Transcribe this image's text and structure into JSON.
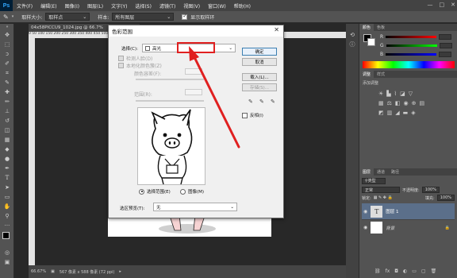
{
  "menubar": {
    "logo": "Ps",
    "items": [
      "文件(F)",
      "编辑(E)",
      "图像(I)",
      "图层(L)",
      "文字(Y)",
      "选择(S)",
      "滤镜(T)",
      "视图(V)",
      "窗口(W)",
      "帮助(H)"
    ],
    "controls": [
      "—",
      "□",
      "✕"
    ]
  },
  "optionsbar": {
    "sample_size_label": "取样大小:",
    "sample_size_value": "取样点",
    "sample_label": "样本:",
    "sample_value": "所有图层",
    "show_ring_label": "显示取样环"
  },
  "document": {
    "tab_title": "04x58PICCU9_1024.jpg @ 66.7%",
    "ruler_marks": "0    50    100   150   200   250   300   350   400   450   500",
    "zoom": "66.67%",
    "doc_info": "567 像素 x 588 像素 (72 ppi)"
  },
  "dialog": {
    "title": "色彩范围",
    "select_label": "选择(C):",
    "select_value": "高光",
    "detect_faces": "检测人脸(D)",
    "localized": "本地化颜色簇(Z)",
    "fuzziness": "颜色容差(F):",
    "range": "范围(R):",
    "ok": "确定",
    "cancel": "取消",
    "load": "载入(L)...",
    "save": "存储(S)...",
    "invert": "反相(I)",
    "radio_selection": "选择范围(E)",
    "radio_image": "图像(M)",
    "preview_label": "选区预览(T):",
    "preview_value": "无"
  },
  "panels": {
    "color_tabs": [
      "颜色",
      "色板"
    ],
    "rgb": [
      "R",
      "G",
      "B"
    ],
    "rgb_values": [
      "",
      "",
      ""
    ],
    "adjust_tabs": [
      "调整",
      "样式"
    ],
    "adjust_label": "添加调整",
    "layer_tabs": [
      "图层",
      "通道",
      "路径"
    ],
    "kind_label": "类型",
    "blend_mode": "正常",
    "opacity_label": "不透明度:",
    "opacity_value": "100%",
    "lock_label": "锁定:",
    "fill_label": "填充:",
    "fill_value": "100%",
    "layers": [
      {
        "name": "图层 1",
        "thumb": "T"
      },
      {
        "name": "背景",
        "thumb": ""
      }
    ]
  },
  "colors": {
    "accent_red": "#e02020",
    "ps_blue": "#31a8ff"
  }
}
